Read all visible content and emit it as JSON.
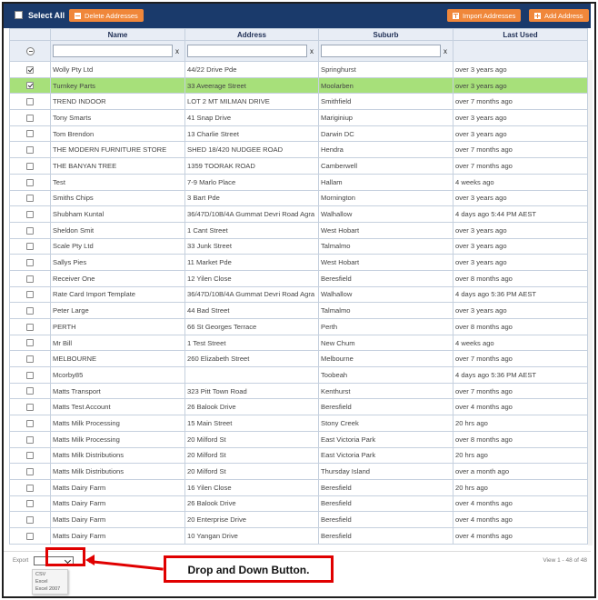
{
  "toolbar": {
    "select_all": "Select All",
    "delete": "Delete Addresses",
    "import": "Import Addresses",
    "add": "Add Address"
  },
  "columns": [
    "Name",
    "Address",
    "Suburb",
    "Last Used"
  ],
  "filter_clear": "x",
  "rows": [
    {
      "checked": true,
      "selected": false,
      "name": "Wolly Pty Ltd",
      "address": "44/22 Drive Pde",
      "suburb": "Springhurst",
      "last_used": "over 3 years ago"
    },
    {
      "checked": true,
      "selected": true,
      "name": "Turnkey Parts",
      "address": "33 Aveerage Street",
      "suburb": "Moolarben",
      "last_used": "over 3 years ago"
    },
    {
      "checked": false,
      "selected": false,
      "name": "TREND INDOOR",
      "address": "LOT 2 MT MILMAN DRIVE",
      "suburb": "Smithfield",
      "last_used": "over 7 months ago"
    },
    {
      "checked": false,
      "selected": false,
      "name": "Tony Smarts",
      "address": "41 Snap Drive",
      "suburb": "Mariginiup",
      "last_used": "over 3 years ago"
    },
    {
      "checked": false,
      "selected": false,
      "name": "Tom Brendon",
      "address": "13 Charlie Street",
      "suburb": "Darwin DC",
      "last_used": "over 3 years ago"
    },
    {
      "checked": false,
      "selected": false,
      "name": "THE MODERN FURNITURE STORE",
      "address": "SHED 18/420 NUDGEE ROAD",
      "suburb": "Hendra",
      "last_used": "over 7 months ago"
    },
    {
      "checked": false,
      "selected": false,
      "name": "THE BANYAN TREE",
      "address": "1359 TOORAK ROAD",
      "suburb": "Camberwell",
      "last_used": "over 7 months ago"
    },
    {
      "checked": false,
      "selected": false,
      "name": "Test",
      "address": "7-9 Marlo Place",
      "suburb": "Hallam",
      "last_used": "4 weeks ago"
    },
    {
      "checked": false,
      "selected": false,
      "name": "Smiths Chips",
      "address": "3 Bart Pde",
      "suburb": "Mornington",
      "last_used": "over 3 years ago"
    },
    {
      "checked": false,
      "selected": false,
      "name": "Shubham Kuntal",
      "address": "36/47D/10B/4A Gummat Devri Road Agra",
      "suburb": "Walhallow",
      "last_used": "4 days ago 5:44 PM AEST"
    },
    {
      "checked": false,
      "selected": false,
      "name": "Sheldon Smit",
      "address": "1 Cant Street",
      "suburb": "West Hobart",
      "last_used": "over 3 years ago"
    },
    {
      "checked": false,
      "selected": false,
      "name": "Scale Pty Ltd",
      "address": "33 Junk Street",
      "suburb": "Talmalmo",
      "last_used": "over 3 years ago"
    },
    {
      "checked": false,
      "selected": false,
      "name": "Sallys Pies",
      "address": "11 Market Pde",
      "suburb": "West Hobart",
      "last_used": "over 3 years ago"
    },
    {
      "checked": false,
      "selected": false,
      "name": "Receiver One",
      "address": "12 Yilen Close",
      "suburb": "Beresfield",
      "last_used": "over 8 months ago"
    },
    {
      "checked": false,
      "selected": false,
      "name": "Rate Card Import Template",
      "address": "36/47D/10B/4A Gummat Devri Road Agra",
      "suburb": "Walhallow",
      "last_used": "4 days ago 5:36 PM AEST"
    },
    {
      "checked": false,
      "selected": false,
      "name": "Peter Large",
      "address": "44 Bad Street",
      "suburb": "Talmalmo",
      "last_used": "over 3 years ago"
    },
    {
      "checked": false,
      "selected": false,
      "name": "PERTH",
      "address": "66 St Georges Terrace",
      "suburb": "Perth",
      "last_used": "over 8 months ago"
    },
    {
      "checked": false,
      "selected": false,
      "name": "Mr Bill",
      "address": "1 Test Street",
      "suburb": "New Chum",
      "last_used": "4 weeks ago"
    },
    {
      "checked": false,
      "selected": false,
      "name": "MELBOURNE",
      "address": "260 Elizabeth Street",
      "suburb": "Melbourne",
      "last_used": "over 7 months ago"
    },
    {
      "checked": false,
      "selected": false,
      "name": "Mcorby85",
      "address": "",
      "suburb": "Toobeah",
      "last_used": "4 days ago 5:36 PM AEST"
    },
    {
      "checked": false,
      "selected": false,
      "name": "Matts Transport",
      "address": "323 Pitt Town Road",
      "suburb": "Kenthurst",
      "last_used": "over 7 months ago"
    },
    {
      "checked": false,
      "selected": false,
      "name": "Matts Test Account",
      "address": "26 Balook Drive",
      "suburb": "Beresfield",
      "last_used": "over 4 months ago"
    },
    {
      "checked": false,
      "selected": false,
      "name": "Matts Milk Processing",
      "address": "15 Main Street",
      "suburb": "Stony Creek",
      "last_used": "20 hrs ago"
    },
    {
      "checked": false,
      "selected": false,
      "name": "Matts Milk Processing",
      "address": "20 Milford St",
      "suburb": "East Victoria Park",
      "last_used": "over 8 months ago"
    },
    {
      "checked": false,
      "selected": false,
      "name": "Matts Milk Distributions",
      "address": "20 Milford St",
      "suburb": "East Victoria Park",
      "last_used": "20 hrs ago"
    },
    {
      "checked": false,
      "selected": false,
      "name": "Matts Milk Distributions",
      "address": "20 Milford St",
      "suburb": "Thursday Island",
      "last_used": "over a month ago"
    },
    {
      "checked": false,
      "selected": false,
      "name": "Matts Dairy Farm",
      "address": "16 Yilen Close",
      "suburb": "Beresfield",
      "last_used": "20 hrs ago"
    },
    {
      "checked": false,
      "selected": false,
      "name": "Matts Dairy Farm",
      "address": "26 Balook Drive",
      "suburb": "Beresfield",
      "last_used": "over 4 months ago"
    },
    {
      "checked": false,
      "selected": false,
      "name": "Matts Dairy Farm",
      "address": "20 Enterprise Drive",
      "suburb": "Beresfield",
      "last_used": "over 4 months ago"
    },
    {
      "checked": false,
      "selected": false,
      "name": "Matts Dairy Farm",
      "address": "10 Yangan Drive",
      "suburb": "Beresfield",
      "last_used": "over 4 months ago"
    }
  ],
  "footer": {
    "export_label": "Export",
    "view_info": "View 1 - 48 of 48",
    "export_options": [
      "CSV",
      "Excel",
      "Excel 2007"
    ]
  },
  "annotation": {
    "callout_text": "Drop and Down Button."
  },
  "colors": {
    "toolbar_bg": "#1a3a6b",
    "button_orange": "#f0873a",
    "selected_row": "#a7e07a",
    "annotation_red": "#e00000"
  },
  "icons": {
    "delete": "minus-icon",
    "import": "upload-icon",
    "add": "plus-icon"
  }
}
